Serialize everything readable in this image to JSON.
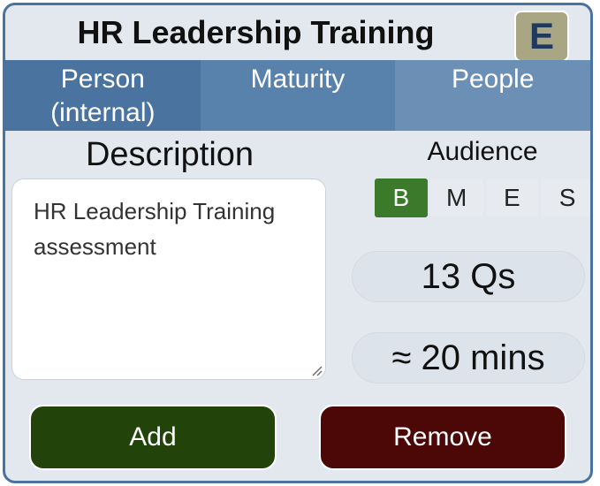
{
  "card": {
    "title": "HR Leadership Training",
    "level_badge": "E"
  },
  "tabs": [
    {
      "label": "Person\n(internal)"
    },
    {
      "label": "Maturity"
    },
    {
      "label": "People"
    }
  ],
  "description": {
    "heading": "Description",
    "text": "HR Leadership Training assessment"
  },
  "audience": {
    "heading": "Audience",
    "options": [
      {
        "label": "B",
        "selected": true
      },
      {
        "label": "M",
        "selected": false
      },
      {
        "label": "E",
        "selected": false
      },
      {
        "label": "S",
        "selected": false
      }
    ],
    "selected_color": "#3a7a2a"
  },
  "stats": {
    "questions": "13 Qs",
    "duration": "≈ 20 mins"
  },
  "actions": {
    "add_label": "Add",
    "remove_label": "Remove",
    "add_color": "#22440a",
    "remove_color": "#4c0707"
  },
  "colors": {
    "border": "#4a73a0",
    "background": "#e3e8ee",
    "badge": "#a8a683"
  }
}
